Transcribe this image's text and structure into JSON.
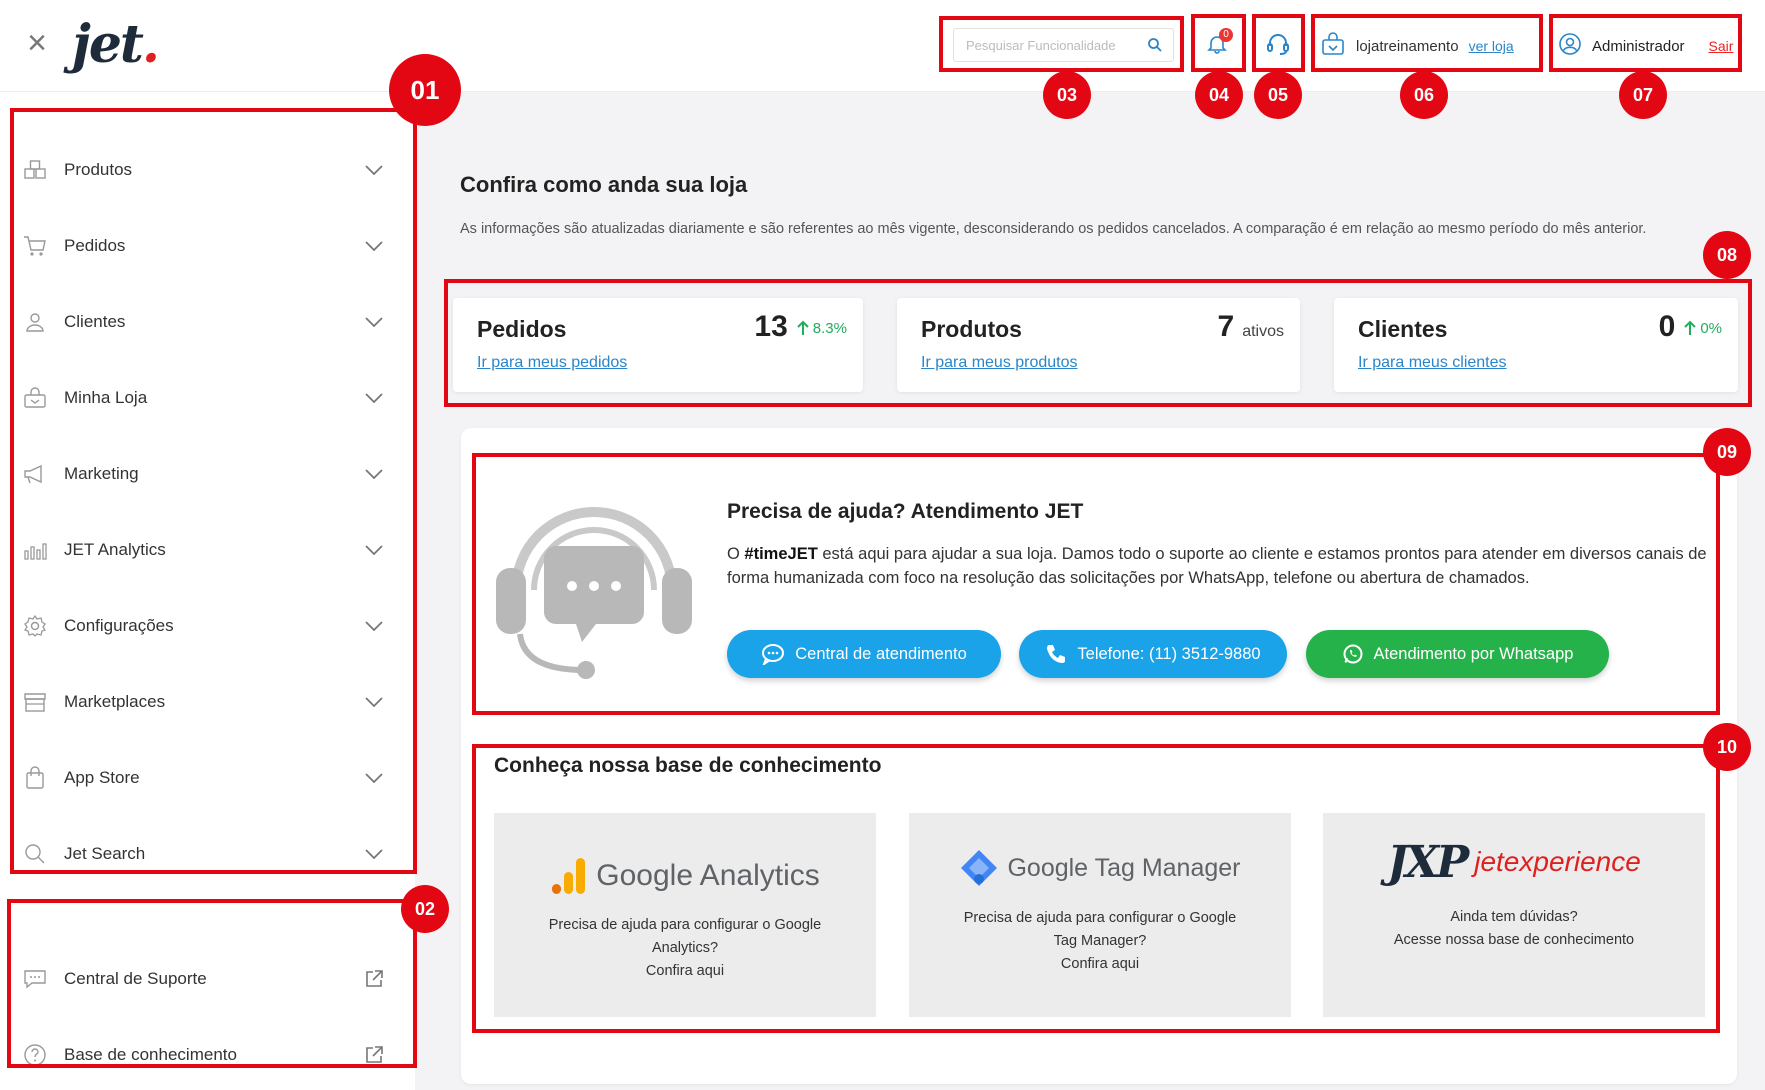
{
  "header": {
    "logo_text": "jet",
    "search_placeholder": "Pesquisar Funcionalidade",
    "notification_count": "0",
    "store_name": "lojatreinamento",
    "store_link": "ver loja",
    "user_name": "Administrador",
    "logout_label": "Sair"
  },
  "sidebar": {
    "items": [
      {
        "label": "Produtos",
        "icon": "boxes-icon"
      },
      {
        "label": "Pedidos",
        "icon": "cart-icon"
      },
      {
        "label": "Clientes",
        "icon": "user-icon"
      },
      {
        "label": "Minha Loja",
        "icon": "store-bag-icon"
      },
      {
        "label": "Marketing",
        "icon": "megaphone-icon"
      },
      {
        "label": "JET Analytics",
        "icon": "bar-chart-icon"
      },
      {
        "label": "Configurações",
        "icon": "gear-icon"
      },
      {
        "label": "Marketplaces",
        "icon": "storefront-icon"
      },
      {
        "label": "App Store",
        "icon": "shopping-bag-icon"
      },
      {
        "label": "Jet Search",
        "icon": "search-icon"
      }
    ],
    "support_items": [
      {
        "label": "Central de Suporte",
        "icon": "chat-icon"
      },
      {
        "label": "Base de conhecimento",
        "icon": "question-icon"
      }
    ]
  },
  "main": {
    "title": "Confira como anda sua loja",
    "description": "As informações são atualizadas diariamente e são referentes ao mês vigente, desconsiderando os pedidos cancelados. A comparação é em relação ao mesmo período do mês anterior.",
    "stats": [
      {
        "title": "Pedidos",
        "value": "13",
        "change": "8.3%",
        "link": "Ir para meus pedidos"
      },
      {
        "title": "Produtos",
        "value": "7",
        "suffix": "ativos",
        "link": "Ir para meus produtos"
      },
      {
        "title": "Clientes",
        "value": "0",
        "change": "0%",
        "link": "Ir para meus clientes"
      }
    ],
    "help": {
      "title": "Precisa de ajuda? Atendimento JET",
      "text_strong": "#timeJET",
      "text_pre": "O ",
      "text_post": " está aqui para ajudar a sua loja. Damos todo o suporte ao cliente e estamos prontos para atender em diversos canais de forma humanizada com foco na resolução das solicitações por WhatsApp, telefone ou abertura de chamados.",
      "buttons": [
        "Central de atendimento",
        "Telefone: (11) 3512-9880",
        "Atendimento por Whatsapp"
      ]
    },
    "knowledge": {
      "title": "Conheça nossa base de conhecimento",
      "cards": [
        {
          "logo": "Google Analytics",
          "lines": [
            "Precisa de ajuda para configurar o Google",
            "Analytics?",
            "Confira aqui"
          ]
        },
        {
          "logo": "Google Tag Manager",
          "lines": [
            "Precisa de ajuda para configurar o Google",
            "Tag Manager?",
            "Confira aqui"
          ]
        },
        {
          "logo_mark": "JXP",
          "logo_word": "jetexperience",
          "lines": [
            "Ainda tem dúvidas?",
            "Acesse nossa base de conhecimento"
          ]
        }
      ]
    }
  },
  "annotations": [
    "01",
    "02",
    "03",
    "04",
    "05",
    "06",
    "07",
    "08",
    "09",
    "10"
  ],
  "colors": {
    "annotation": "#e30613",
    "link": "#2a86c8",
    "positive": "#1fae5b",
    "button_blue": "#1aa3e8",
    "button_green": "#26b24a"
  }
}
